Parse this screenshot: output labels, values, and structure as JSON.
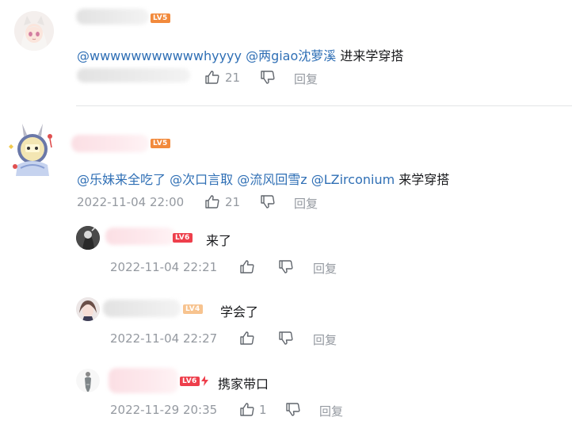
{
  "comments": [
    {
      "level": "LV5",
      "mentions": [
        "@wwwwwwwwwwwhyyyy",
        "@两giao沈萝溪"
      ],
      "text": "进来学穿搭",
      "likes": "21",
      "reply_label": "回复"
    },
    {
      "level": "LV5",
      "mentions": [
        "@乐妹来全吃了",
        "@次口言取",
        "@流风回雪z",
        "@LZirconium"
      ],
      "text": "来学穿搭",
      "timestamp": "2022-11-04 22:00",
      "likes": "21",
      "reply_label": "回复",
      "replies": [
        {
          "level": "LV6",
          "text": "来了",
          "timestamp": "2022-11-04 22:21",
          "reply_label": "回复"
        },
        {
          "level": "LV4",
          "text": "学会了",
          "timestamp": "2022-11-04 22:27",
          "reply_label": "回复"
        },
        {
          "level": "LV6",
          "text": "携家带口",
          "timestamp": "2022-11-29 20:35",
          "likes": "1",
          "reply_label": "回复"
        }
      ]
    }
  ],
  "colors": {
    "mention": "#2f6fb5",
    "meta": "#9499a0",
    "lv5": "#f28a3c",
    "lv6": "#ee3f4c",
    "lv4": "#f7c38f"
  }
}
